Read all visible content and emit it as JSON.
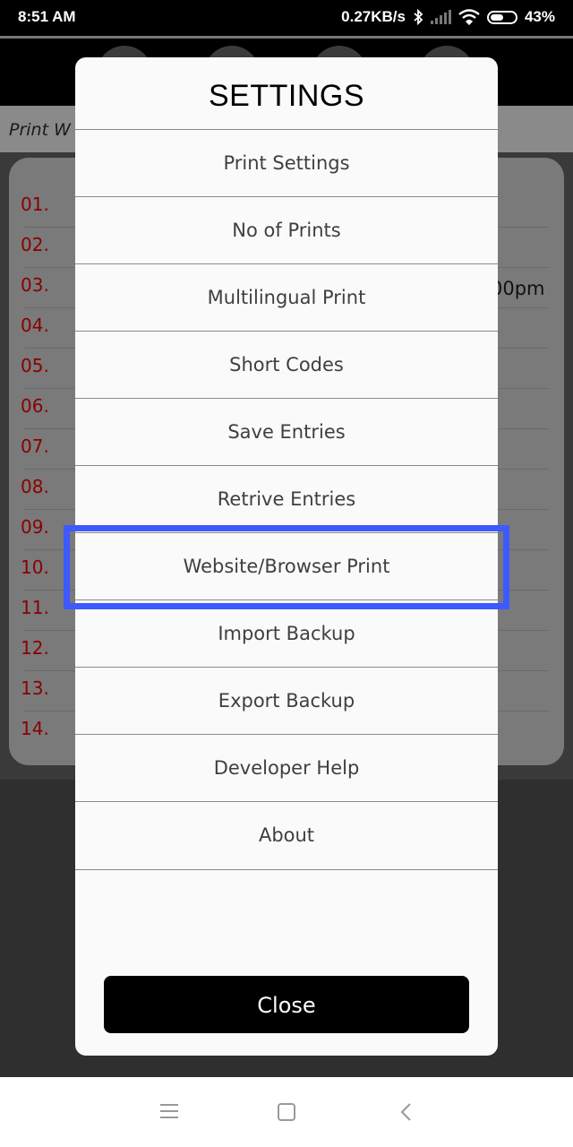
{
  "status_bar": {
    "time": "8:51 AM",
    "network_speed": "0.27KB/s",
    "battery": "43%",
    "icons": [
      "bluetooth-icon",
      "signal-icon",
      "wifi-icon",
      "battery-icon"
    ]
  },
  "background": {
    "subheader_label": "Print W",
    "rows": [
      "01.",
      "02.",
      "03.",
      "04.",
      "05.",
      "06.",
      "07.",
      "08.",
      "09.",
      "10.",
      "11.",
      "12.",
      "13.",
      "14."
    ],
    "time_fragment": "00pm"
  },
  "dialog": {
    "title": "SETTINGS",
    "items": [
      "Print Settings",
      "No of Prints",
      "Multilingual Print",
      "Short Codes",
      "Save Entries",
      "Retrive Entries",
      "Website/Browser Print",
      "Import Backup",
      "Export Backup",
      "Developer Help",
      "About"
    ],
    "close_label": "Close",
    "highlighted_item": "Website/Browser Print"
  },
  "nav_bar": {
    "icons": [
      "menu-icon",
      "home-square-icon",
      "back-icon"
    ]
  },
  "colors": {
    "highlight": "#3d5afe",
    "row_number": "#8a0000"
  }
}
